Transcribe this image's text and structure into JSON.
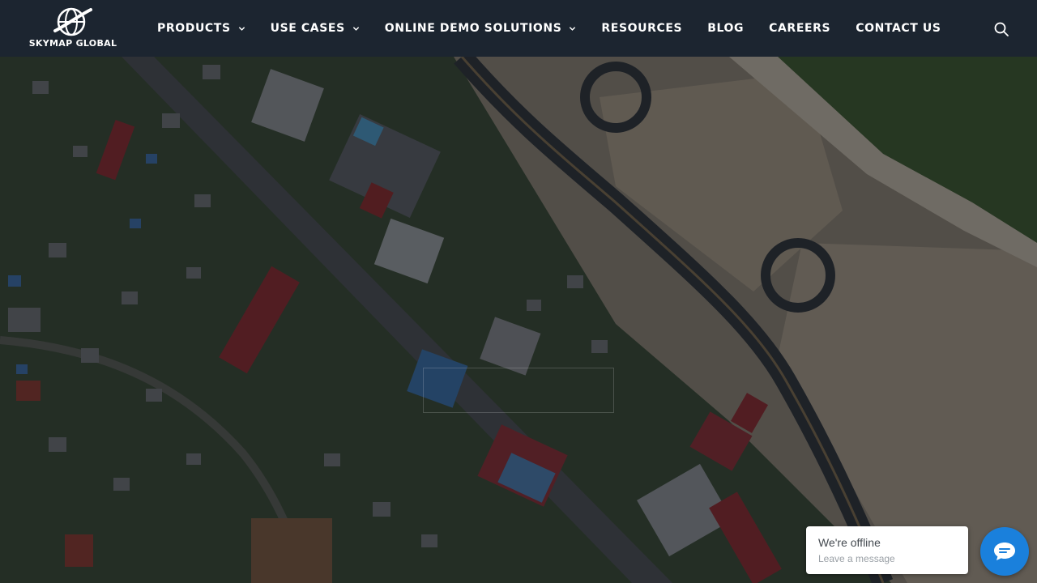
{
  "brand": {
    "logo_text": "SKYMAP GLOBAL",
    "logo_icon": "globe-swoosh-icon"
  },
  "nav": {
    "items": [
      {
        "label": "PRODUCTS",
        "has_dropdown": true
      },
      {
        "label": "USE CASES",
        "has_dropdown": true
      },
      {
        "label": "ONLINE DEMO SOLUTIONS",
        "has_dropdown": true
      },
      {
        "label": "RESOURCES",
        "has_dropdown": false
      },
      {
        "label": "BLOG",
        "has_dropdown": false
      },
      {
        "label": "CAREERS",
        "has_dropdown": false
      },
      {
        "label": "CONTACT US",
        "has_dropdown": false
      }
    ],
    "search_icon": "search-icon"
  },
  "chat": {
    "title": "We're offline",
    "subtitle": "Leave a message",
    "icon": "chat-icon"
  },
  "colors": {
    "header_bg": "#1c2530",
    "chat_accent": "#1a80dc"
  }
}
